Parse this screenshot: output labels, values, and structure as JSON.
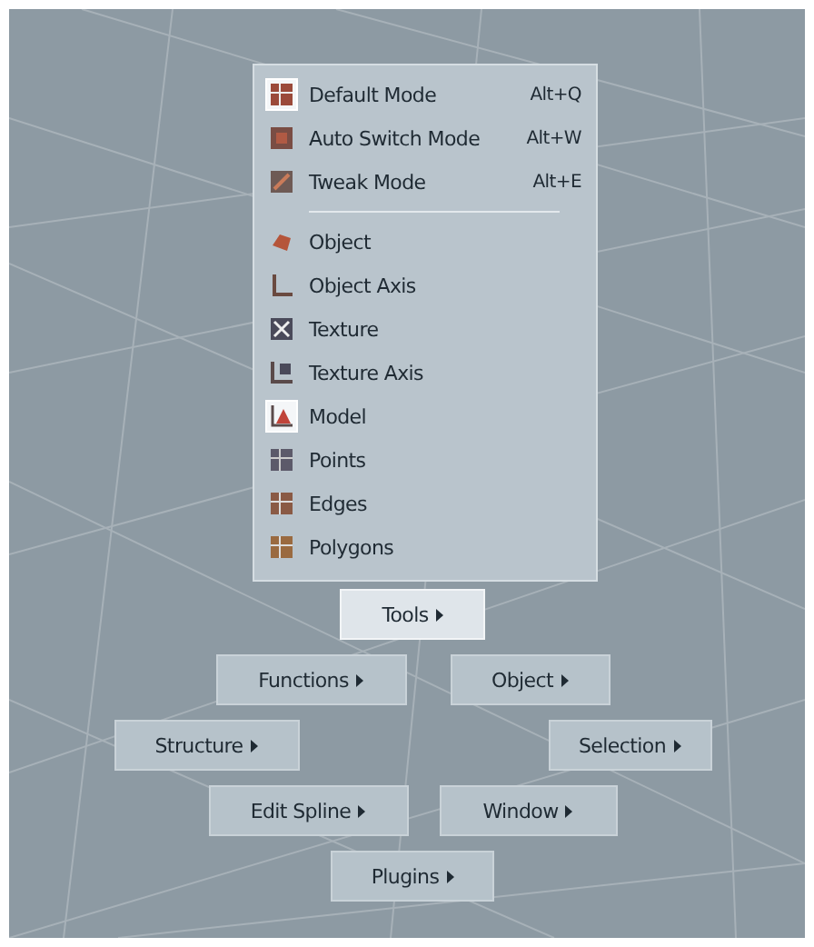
{
  "menu": {
    "groups": [
      [
        {
          "label": "Default Mode",
          "shortcut": "Alt+Q",
          "selected": true
        },
        {
          "label": "Auto Switch Mode",
          "shortcut": "Alt+W",
          "selected": false
        },
        {
          "label": "Tweak Mode",
          "shortcut": "Alt+E",
          "selected": false
        }
      ],
      [
        {
          "label": "Object",
          "selected": false
        },
        {
          "label": "Object Axis",
          "selected": false
        },
        {
          "label": "Texture",
          "selected": false
        },
        {
          "label": "Texture Axis",
          "selected": false
        },
        {
          "label": "Model",
          "selected": true
        },
        {
          "label": "Points",
          "selected": false
        },
        {
          "label": "Edges",
          "selected": false
        },
        {
          "label": "Polygons",
          "selected": false
        }
      ]
    ]
  },
  "button_rows": [
    [
      {
        "label": "Tools",
        "selected": true
      }
    ],
    [
      {
        "label": "Functions",
        "selected": false
      },
      {
        "label": "Object",
        "selected": false
      }
    ],
    [
      {
        "label": "Structure",
        "selected": false
      },
      {
        "label": "Selection",
        "selected": false
      }
    ],
    [
      {
        "label": "Edit Spline",
        "selected": false
      },
      {
        "label": "Window",
        "selected": false
      }
    ],
    [
      {
        "label": "Plugins",
        "selected": false
      }
    ]
  ]
}
